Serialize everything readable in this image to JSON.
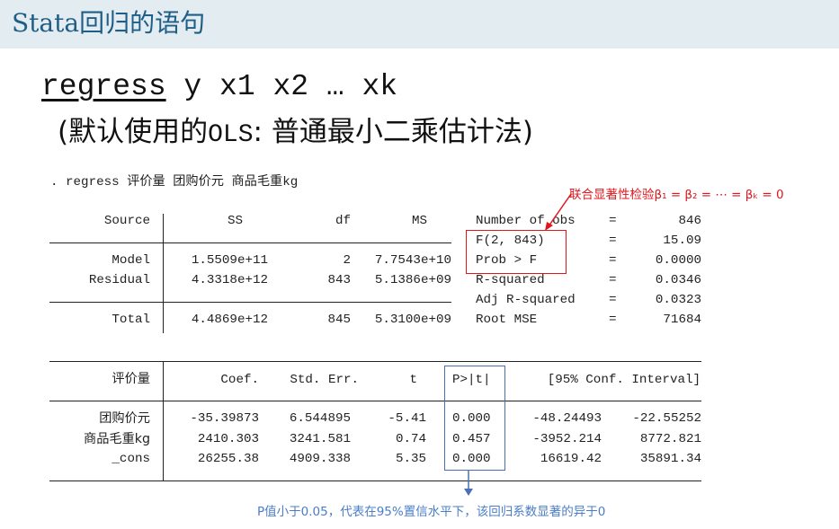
{
  "slide": {
    "title": "Stata回归的语句",
    "command_first": "regress",
    "command_rest": " y x1 x2 … xk",
    "command_sub_open": "(默认使用的",
    "command_sub_ols": "OLS",
    "command_sub_rest": ": 普通最小二乘估计法)"
  },
  "output": {
    "prompt": ". regress 评价量 团购价元 商品毛重kg",
    "anova": {
      "headers": [
        "Source",
        "SS",
        "df",
        "MS"
      ],
      "rows": [
        {
          "source": "Model",
          "ss": "1.5509e+11",
          "df": "2",
          "ms": "7.7543e+10"
        },
        {
          "source": "Residual",
          "ss": "4.3318e+12",
          "df": "843",
          "ms": "5.1386e+09"
        },
        {
          "source": "Total",
          "ss": "4.4869e+12",
          "df": "845",
          "ms": "5.3100e+09"
        }
      ]
    },
    "stats": [
      {
        "label": "Number of obs",
        "eq": "=",
        "value": "846"
      },
      {
        "label": "F(2, 843)",
        "eq": "=",
        "value": "15.09"
      },
      {
        "label": "Prob > F",
        "eq": "=",
        "value": "0.0000"
      },
      {
        "label": "R-squared",
        "eq": "=",
        "value": "0.0346"
      },
      {
        "label": "Adj R-squared",
        "eq": "=",
        "value": "0.0323"
      },
      {
        "label": "Root MSE",
        "eq": "=",
        "value": "71684"
      }
    ],
    "coef": {
      "headers": {
        "var": "评价量",
        "coef": "Coef.",
        "se": "Std. Err.",
        "t": "t",
        "p": "P>|t|",
        "ci": "[95% Conf. Interval]"
      },
      "rows": [
        {
          "var": "团购价元",
          "coef": "-35.39873",
          "se": "6.544895",
          "t": "-5.41",
          "p": "0.000",
          "lo": "-48.24493",
          "hi": "-22.55252"
        },
        {
          "var": "商品毛重kg",
          "coef": "2410.303",
          "se": "3241.581",
          "t": "0.74",
          "p": "0.457",
          "lo": "-3952.214",
          "hi": "8772.821"
        },
        {
          "var": "_cons",
          "coef": "26255.38",
          "se": "4909.338",
          "t": "5.35",
          "p": "0.000",
          "lo": "16619.42",
          "hi": "35891.34"
        }
      ]
    }
  },
  "annotations": {
    "joint_test": "联合显著性检验β₁ = β₂ = ⋯ = βₖ = 0",
    "p_value_note": "P值小于0.05，代表在95%置信水平下，该回归系数显著的异于0",
    "red_color": "#e0161c",
    "blue_color": "#4a6fb5"
  }
}
